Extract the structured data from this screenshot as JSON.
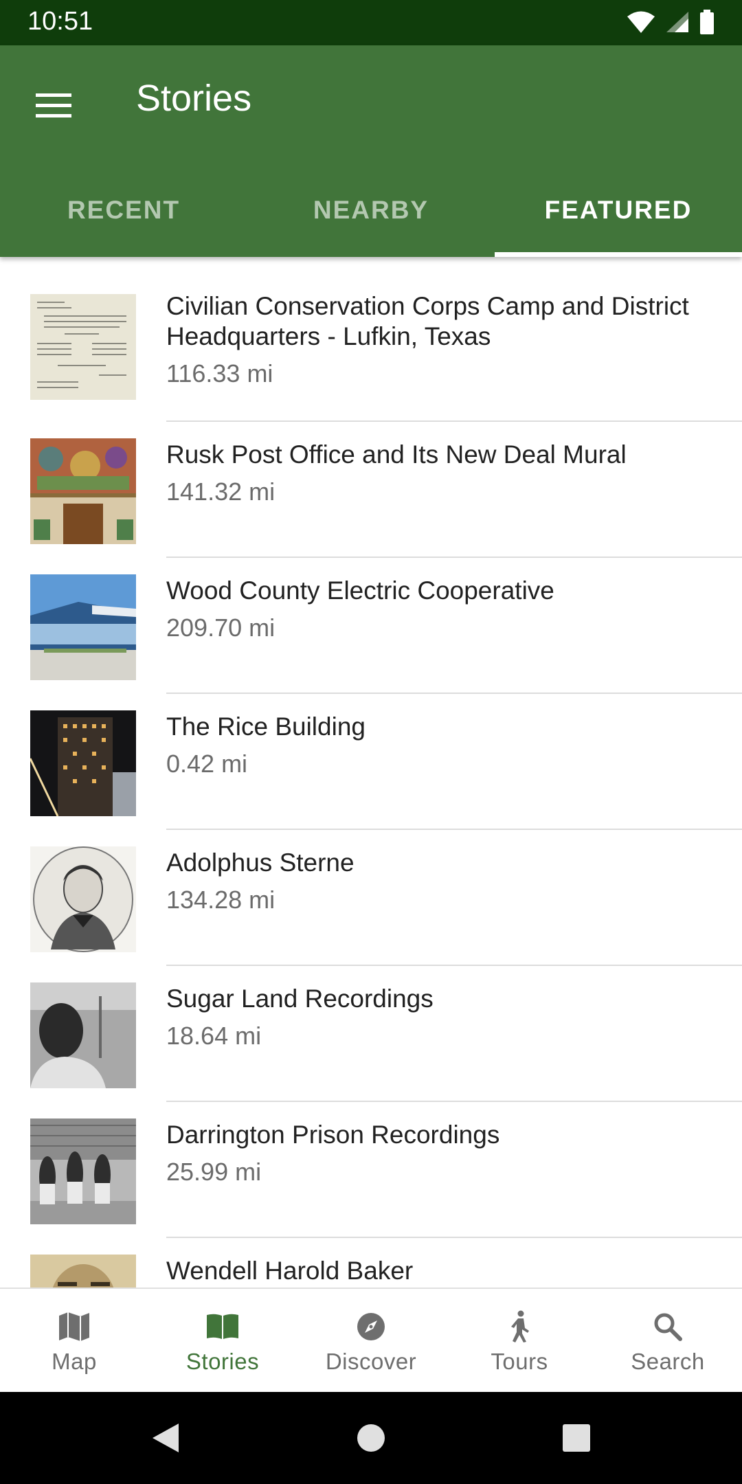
{
  "status_bar": {
    "time": "10:51"
  },
  "app_bar": {
    "title": "Stories"
  },
  "tabs": [
    {
      "label": "RECENT",
      "active": false
    },
    {
      "label": "NEARBY",
      "active": false
    },
    {
      "label": "FEATURED",
      "active": true
    }
  ],
  "stories": [
    {
      "title": "Civilian Conservation Corps Camp and District Headquarters - Lufkin, Texas",
      "distance": "116.33 mi",
      "thumb": "typed-document"
    },
    {
      "title": "Rusk Post Office and Its New Deal Mural",
      "distance": "141.32 mi",
      "thumb": "mural-doorway"
    },
    {
      "title": "Wood County Electric Cooperative",
      "distance": "209.70 mi",
      "thumb": "modern-building"
    },
    {
      "title": "The Rice Building",
      "distance": "0.42 mi",
      "thumb": "night-building"
    },
    {
      "title": "Adolphus Sterne",
      "distance": "134.28 mi",
      "thumb": "engraved-portrait"
    },
    {
      "title": "Sugar Land Recordings",
      "distance": "18.64 mi",
      "thumb": "bw-photo-man"
    },
    {
      "title": "Darrington Prison Recordings",
      "distance": "25.99 mi",
      "thumb": "bw-photo-workers"
    },
    {
      "title": "Wendell Harold Baker",
      "distance": "",
      "thumb": "bw-photo-portrait"
    }
  ],
  "bottom_nav": [
    {
      "label": "Map",
      "icon": "map-icon",
      "active": false
    },
    {
      "label": "Stories",
      "icon": "book-icon",
      "active": true
    },
    {
      "label": "Discover",
      "icon": "compass-icon",
      "active": false
    },
    {
      "label": "Tours",
      "icon": "walking-icon",
      "active": false
    },
    {
      "label": "Search",
      "icon": "search-icon",
      "active": false
    }
  ],
  "colors": {
    "status_bar": "#0f3d0b",
    "primary": "#41753a",
    "inactive_nav": "#6e6e6e"
  }
}
